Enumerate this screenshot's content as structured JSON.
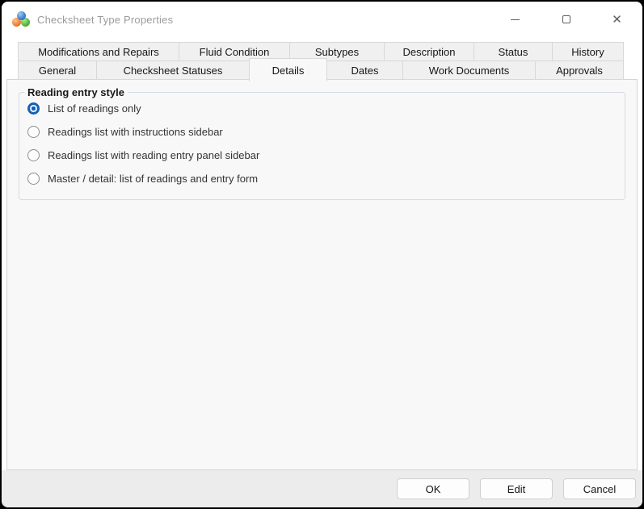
{
  "window": {
    "title": "Checksheet Type Properties",
    "icon": "app-logo-three-spheres",
    "controls": {
      "minimize": "minimize-icon",
      "maximize": "maximize-icon",
      "close": "close-icon",
      "close_glyph": "✕"
    }
  },
  "tabs": {
    "row1": [
      "Modifications and Repairs",
      "Fluid Condition",
      "Subtypes",
      "Description",
      "Status",
      "History"
    ],
    "row2": [
      "General",
      "Checksheet Statuses",
      "Details",
      "Dates",
      "Work Documents",
      "Approvals"
    ],
    "selected": "Details"
  },
  "details_tab": {
    "group_title": "Reading entry style",
    "options": [
      {
        "label": "List of readings only",
        "selected": true
      },
      {
        "label": "Readings list with instructions sidebar",
        "selected": false
      },
      {
        "label": "Readings list with reading entry panel sidebar",
        "selected": false
      },
      {
        "label": "Master / detail: list of readings and entry form",
        "selected": false
      }
    ]
  },
  "footer": {
    "buttons": [
      "OK",
      "Edit",
      "Cancel"
    ]
  },
  "colors": {
    "radio_accent": "#1462b8",
    "titlebar_text": "#9b9b9b",
    "tab_inactive_bg": "#f0f0f0",
    "panel_bg": "#f8f8f8",
    "footer_bg": "#ececec"
  }
}
